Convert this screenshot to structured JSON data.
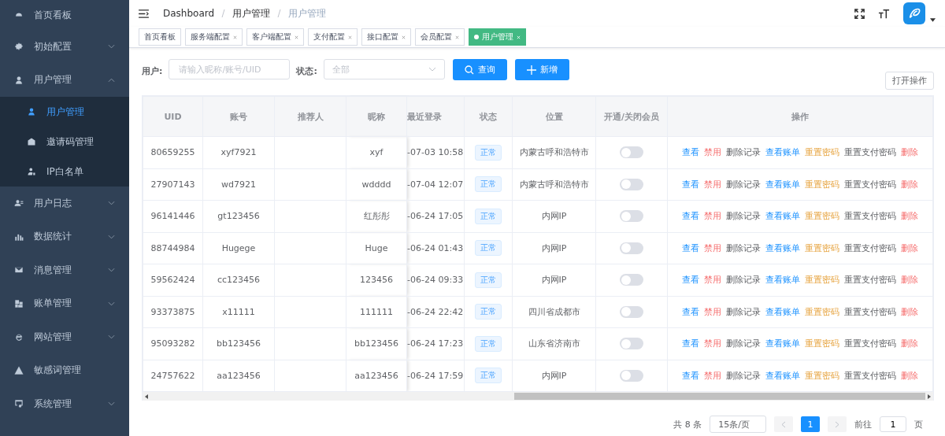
{
  "sidebar": {
    "items": [
      {
        "label": "首页看板"
      },
      {
        "label": "初始配置",
        "expanded": false
      },
      {
        "label": "用户管理",
        "expanded": true,
        "children": [
          {
            "label": "用户管理",
            "selected": true
          },
          {
            "label": "邀请码管理",
            "selected": false
          },
          {
            "label": "IP白名单",
            "selected": false
          }
        ]
      },
      {
        "label": "用户日志",
        "expanded": false
      },
      {
        "label": "数据统计",
        "expanded": false
      },
      {
        "label": "消息管理",
        "expanded": false
      },
      {
        "label": "账单管理",
        "expanded": false
      },
      {
        "label": "网站管理",
        "expanded": false
      },
      {
        "label": "敏感词管理"
      },
      {
        "label": "系统管理",
        "expanded": false
      }
    ]
  },
  "breadcrumb": [
    "Dashboard",
    "用户管理",
    "用户管理"
  ],
  "tags": [
    {
      "label": "首页看板",
      "selected": false,
      "closable": false
    },
    {
      "label": "服务端配置",
      "selected": false,
      "closable": true
    },
    {
      "label": "客户端配置",
      "selected": false,
      "closable": true
    },
    {
      "label": "支付配置",
      "selected": false,
      "closable": true
    },
    {
      "label": "接口配置",
      "selected": false,
      "closable": true
    },
    {
      "label": "会员配置",
      "selected": false,
      "closable": true
    },
    {
      "label": "用户管理",
      "selected": true,
      "closable": true
    }
  ],
  "filter": {
    "user_label": "用户:",
    "user_placeholder": "请输入昵称/账号/UID",
    "status_label": "状态:",
    "status_placeholder": "全部",
    "search_button": "查询",
    "add_button": "新增",
    "open_button": "打开操作"
  },
  "table": {
    "columns": [
      "UID",
      "账号",
      "推荐人",
      "昵称",
      "最近登录",
      "状态",
      "位置",
      "开通/关闭会员",
      "操作"
    ],
    "rows": [
      {
        "uid": "80659255",
        "account": "xyf7921",
        "nickname": "xyf",
        "last_login": "-07-03 10:58",
        "status": "正常",
        "location": "内蒙古呼和浩特市",
        "vip_on": false,
        "actions": [
          {
            "label": "查看",
            "kind": "primary"
          },
          {
            "label": "禁用",
            "kind": "danger"
          },
          {
            "label": "删除记录",
            "kind": "default"
          },
          {
            "label": "查看账单",
            "kind": "primary"
          },
          {
            "label": "重置密码",
            "kind": "warning"
          },
          {
            "label": "重置支付密码",
            "kind": "default"
          },
          {
            "label": "删除",
            "kind": "danger"
          }
        ]
      },
      {
        "uid": "27907143",
        "account": "wd7921",
        "nickname": "wdddd",
        "last_login": "-07-04 12:07",
        "status": "正常",
        "location": "内蒙古呼和浩特市",
        "vip_on": false,
        "actions": [
          {
            "label": "查看",
            "kind": "primary"
          },
          {
            "label": "禁用",
            "kind": "danger"
          },
          {
            "label": "删除记录",
            "kind": "default"
          },
          {
            "label": "查看账单",
            "kind": "primary"
          },
          {
            "label": "重置密码",
            "kind": "warning"
          },
          {
            "label": "重置支付密码",
            "kind": "default"
          },
          {
            "label": "删除",
            "kind": "danger"
          }
        ]
      },
      {
        "uid": "96141446",
        "account": "gt123456",
        "nickname": "红彤彤",
        "last_login": "-06-24 17:05",
        "status": "正常",
        "location": "内网IP",
        "vip_on": false,
        "actions": [
          {
            "label": "查看",
            "kind": "primary"
          },
          {
            "label": "禁用",
            "kind": "danger"
          },
          {
            "label": "删除记录",
            "kind": "default"
          },
          {
            "label": "查看账单",
            "kind": "primary"
          },
          {
            "label": "重置密码",
            "kind": "warning"
          },
          {
            "label": "重置支付密码",
            "kind": "default"
          },
          {
            "label": "删除",
            "kind": "danger"
          }
        ]
      },
      {
        "uid": "88744984",
        "account": "Hugege",
        "nickname": "Huge",
        "last_login": "-06-24 01:43",
        "status": "正常",
        "location": "内网IP",
        "vip_on": false,
        "actions": [
          {
            "label": "查看",
            "kind": "primary"
          },
          {
            "label": "禁用",
            "kind": "danger"
          },
          {
            "label": "删除记录",
            "kind": "default"
          },
          {
            "label": "查看账单",
            "kind": "primary"
          },
          {
            "label": "重置密码",
            "kind": "warning"
          },
          {
            "label": "重置支付密码",
            "kind": "default"
          },
          {
            "label": "删除",
            "kind": "danger"
          }
        ]
      },
      {
        "uid": "59562424",
        "account": "cc123456",
        "nickname": "123456",
        "last_login": "-06-24 09:33",
        "status": "正常",
        "location": "内网IP",
        "vip_on": false,
        "actions": [
          {
            "label": "查看",
            "kind": "primary"
          },
          {
            "label": "禁用",
            "kind": "danger"
          },
          {
            "label": "删除记录",
            "kind": "default"
          },
          {
            "label": "查看账单",
            "kind": "primary"
          },
          {
            "label": "重置密码",
            "kind": "warning"
          },
          {
            "label": "重置支付密码",
            "kind": "default"
          },
          {
            "label": "删除",
            "kind": "danger"
          }
        ]
      },
      {
        "uid": "93373875",
        "account": "x11111",
        "nickname": "111111",
        "last_login": "-06-24 22:42",
        "status": "正常",
        "location": "四川省成都市",
        "vip_on": false,
        "actions": [
          {
            "label": "查看",
            "kind": "primary"
          },
          {
            "label": "禁用",
            "kind": "danger"
          },
          {
            "label": "删除记录",
            "kind": "default"
          },
          {
            "label": "查看账单",
            "kind": "primary"
          },
          {
            "label": "重置密码",
            "kind": "warning"
          },
          {
            "label": "重置支付密码",
            "kind": "default"
          },
          {
            "label": "删除",
            "kind": "danger"
          }
        ]
      },
      {
        "uid": "95093282",
        "account": "bb123456",
        "nickname": "bb123456",
        "last_login": "-06-24 17:23",
        "status": "正常",
        "location": "山东省济南市",
        "vip_on": false,
        "actions": [
          {
            "label": "查看",
            "kind": "primary"
          },
          {
            "label": "禁用",
            "kind": "danger"
          },
          {
            "label": "删除记录",
            "kind": "default"
          },
          {
            "label": "查看账单",
            "kind": "primary"
          },
          {
            "label": "重置密码",
            "kind": "warning"
          },
          {
            "label": "重置支付密码",
            "kind": "default"
          },
          {
            "label": "删除",
            "kind": "danger"
          }
        ]
      },
      {
        "uid": "24757622",
        "account": "aa123456",
        "nickname": "aa123456",
        "last_login": "-06-24 17:59",
        "status": "正常",
        "location": "内网IP",
        "vip_on": false,
        "actions": [
          {
            "label": "查看",
            "kind": "primary"
          },
          {
            "label": "禁用",
            "kind": "danger"
          },
          {
            "label": "删除记录",
            "kind": "default"
          },
          {
            "label": "查看账单",
            "kind": "primary"
          },
          {
            "label": "重置密码",
            "kind": "warning"
          },
          {
            "label": "重置支付密码",
            "kind": "default"
          },
          {
            "label": "删除",
            "kind": "danger"
          }
        ]
      }
    ]
  },
  "pagination": {
    "total": "共 8 条",
    "page_size": "15条/页",
    "pages": [
      {
        "label": "1",
        "selected": true
      }
    ],
    "goto_label": "前往",
    "goto_value": "1",
    "page_suffix": "页"
  }
}
